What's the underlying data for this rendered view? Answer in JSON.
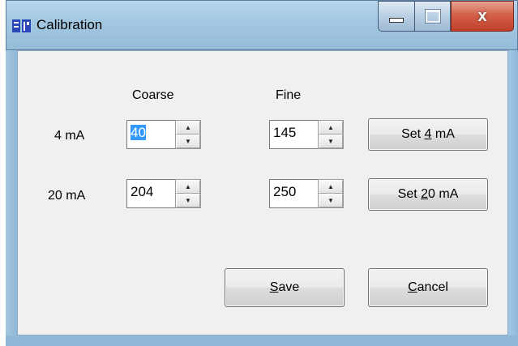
{
  "window": {
    "title": "Calibration",
    "icon": "app-icon",
    "close_glyph": "x"
  },
  "headers": {
    "coarse": "Coarse",
    "fine": "Fine"
  },
  "rows": [
    {
      "label": "4 mA",
      "coarse_value": "40",
      "fine_value": "145",
      "button_prefix": "Set ",
      "button_mnemonic": "4",
      "button_suffix": " mA"
    },
    {
      "label": "20 mA",
      "coarse_value": "204",
      "fine_value": "250",
      "button_prefix": "Set ",
      "button_mnemonic": "2",
      "button_suffix": "0 mA"
    }
  ],
  "actions": {
    "save_mnemonic": "S",
    "save_rest": "ave",
    "cancel_mnemonic": "C",
    "cancel_rest": "ancel"
  },
  "spinner": {
    "up_glyph": "▲",
    "down_glyph": "▼"
  },
  "colors": {
    "selection": "#3399ff",
    "close_button": "#c84a33",
    "frame": "#a4c8e2"
  }
}
